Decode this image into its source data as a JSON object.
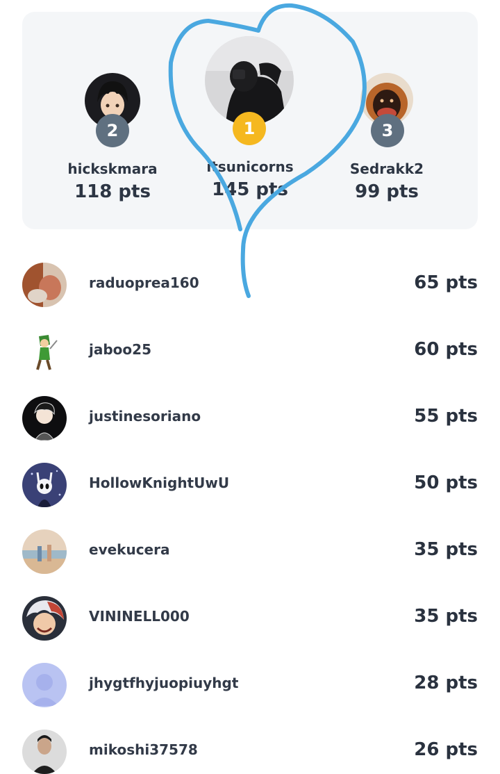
{
  "podium": [
    {
      "rank": "1",
      "name": "itsunicorns",
      "points": "145 pts",
      "avatar": "photo-avatar",
      "rank_color": "#f5b820"
    },
    {
      "rank": "2",
      "name": "hickskmara",
      "points": "118 pts",
      "avatar": "anime-avatar",
      "rank_color": "#5f7080"
    },
    {
      "rank": "3",
      "name": "Sedrakk2",
      "points": "99 pts",
      "avatar": "orangutan-avatar",
      "rank_color": "#5f7080"
    }
  ],
  "leaderboard": [
    {
      "name": "raduoprea160",
      "points": "65 pts",
      "avatar": "photo-avatar"
    },
    {
      "name": "jaboo25",
      "points": "60 pts",
      "avatar": "game-character-avatar"
    },
    {
      "name": "justinesoriano",
      "points": "55 pts",
      "avatar": "cartoon-avatar"
    },
    {
      "name": "HollowKnightUwU",
      "points": "50 pts",
      "avatar": "hollow-knight-avatar"
    },
    {
      "name": "evekucera",
      "points": "35 pts",
      "avatar": "beach-photo-avatar"
    },
    {
      "name": "VININELL000",
      "points": "35 pts",
      "avatar": "anime-avatar"
    },
    {
      "name": "jhygtfhyjuopiuyhgt",
      "points": "28 pts",
      "avatar": "default-user-avatar"
    },
    {
      "name": "mikoshi37578",
      "points": "26 pts",
      "avatar": "photo-avatar"
    }
  ],
  "colors": {
    "doodle": "#4aa8e0",
    "card_bg": "#f4f6f8",
    "gold": "#f5b820",
    "silver": "#5f7080"
  }
}
